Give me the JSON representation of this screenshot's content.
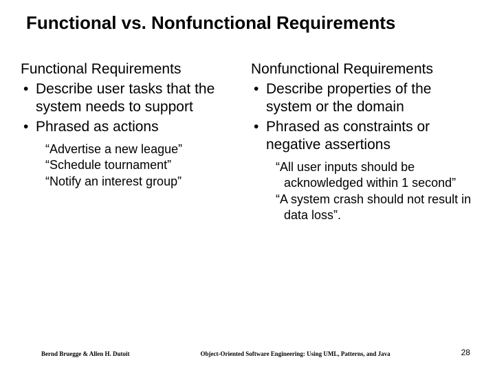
{
  "title": "Functional vs. Nonfunctional Requirements",
  "left": {
    "heading": "Functional Requirements",
    "bullets": [
      "Describe user tasks that the system needs to support",
      "Phrased as actions"
    ],
    "quotes": [
      "“Advertise a new league”",
      "“Schedule tournament”",
      "“Notify an interest group”"
    ]
  },
  "right": {
    "heading": "Nonfunctional Requirements",
    "bullets": [
      "Describe properties of the system or the domain",
      "Phrased as constraints or negative assertions"
    ],
    "quotes": [
      "“All user inputs should be acknowledged within 1 second”",
      "“A system crash should not result in data loss”."
    ]
  },
  "footer": {
    "left": "Bernd Bruegge & Allen H. Dutoit",
    "center": "Object-Oriented Software Engineering: Using UML, Patterns, and Java",
    "right": "28"
  }
}
